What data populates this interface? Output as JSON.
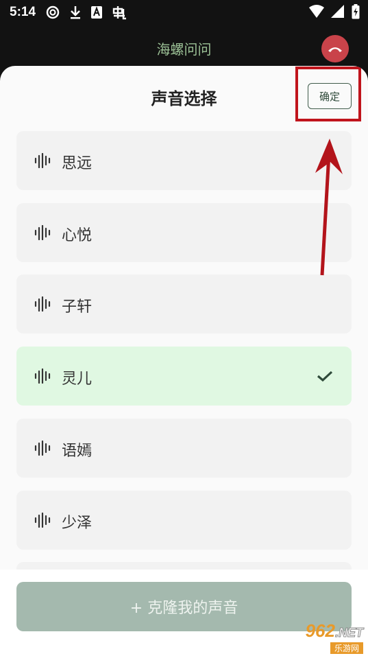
{
  "status_bar": {
    "time": "5:14",
    "icons_left": [
      "sync-icon",
      "download-icon",
      "a-badge-icon",
      "bug-icon"
    ],
    "icons_right": [
      "wifi-icon",
      "signal-icon",
      "battery-charging-icon"
    ]
  },
  "header": {
    "title": "海螺问问",
    "hangup_icon": "phone-hangup-icon",
    "title_color": "#9cc196",
    "hangup_color": "#c9434a"
  },
  "sheet": {
    "title": "声音选择",
    "confirm_label": "确定",
    "voices": [
      {
        "name": "思远",
        "selected": false
      },
      {
        "name": "心悦",
        "selected": false
      },
      {
        "name": "子轩",
        "selected": false
      },
      {
        "name": "灵儿",
        "selected": true
      },
      {
        "name": "语嫣",
        "selected": false
      },
      {
        "name": "少泽",
        "selected": false
      }
    ],
    "selected_bg": "#e0f8e2",
    "item_bg": "#f2f2f2"
  },
  "annotation": {
    "highlight_color": "#c0141c"
  },
  "bottom": {
    "clone_label": "+ 克隆我的声音",
    "clone_bg": "#a4b9ae"
  },
  "watermark": {
    "logo_main": "962",
    "logo_suffix": ".NET",
    "sub": "乐游网"
  }
}
